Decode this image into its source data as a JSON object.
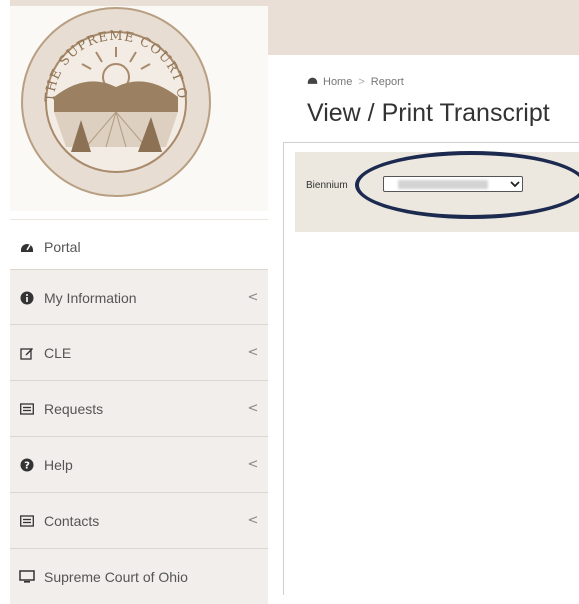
{
  "breadcrumb": {
    "home": "Home",
    "separator": ">",
    "current": "Report"
  },
  "page": {
    "title": "View / Print Transcript"
  },
  "filter": {
    "label": "Biennium",
    "selected_value": "2022-2023"
  },
  "sidebar": {
    "items": [
      {
        "label": "Portal",
        "icon": "dashboard-icon",
        "has_submenu": false
      },
      {
        "label": "My Information",
        "icon": "info-circle-icon",
        "has_submenu": true
      },
      {
        "label": "CLE",
        "icon": "edit-icon",
        "has_submenu": true
      },
      {
        "label": "Requests",
        "icon": "list-icon",
        "has_submenu": true
      },
      {
        "label": "Help",
        "icon": "question-circle-icon",
        "has_submenu": true
      },
      {
        "label": "Contacts",
        "icon": "list-icon",
        "has_submenu": true
      },
      {
        "label": "Supreme Court of Ohio",
        "icon": "monitor-icon",
        "has_submenu": false
      }
    ],
    "chevron": "<"
  },
  "seal": {
    "text": "THE SUPREME COURT OF THE STATE OF OHIO"
  },
  "colors": {
    "topbar": "#e9dfd7",
    "menu_bg": "#f1eeeb",
    "filter_bg": "#ece8df",
    "highlight": "#1b2a4e"
  }
}
